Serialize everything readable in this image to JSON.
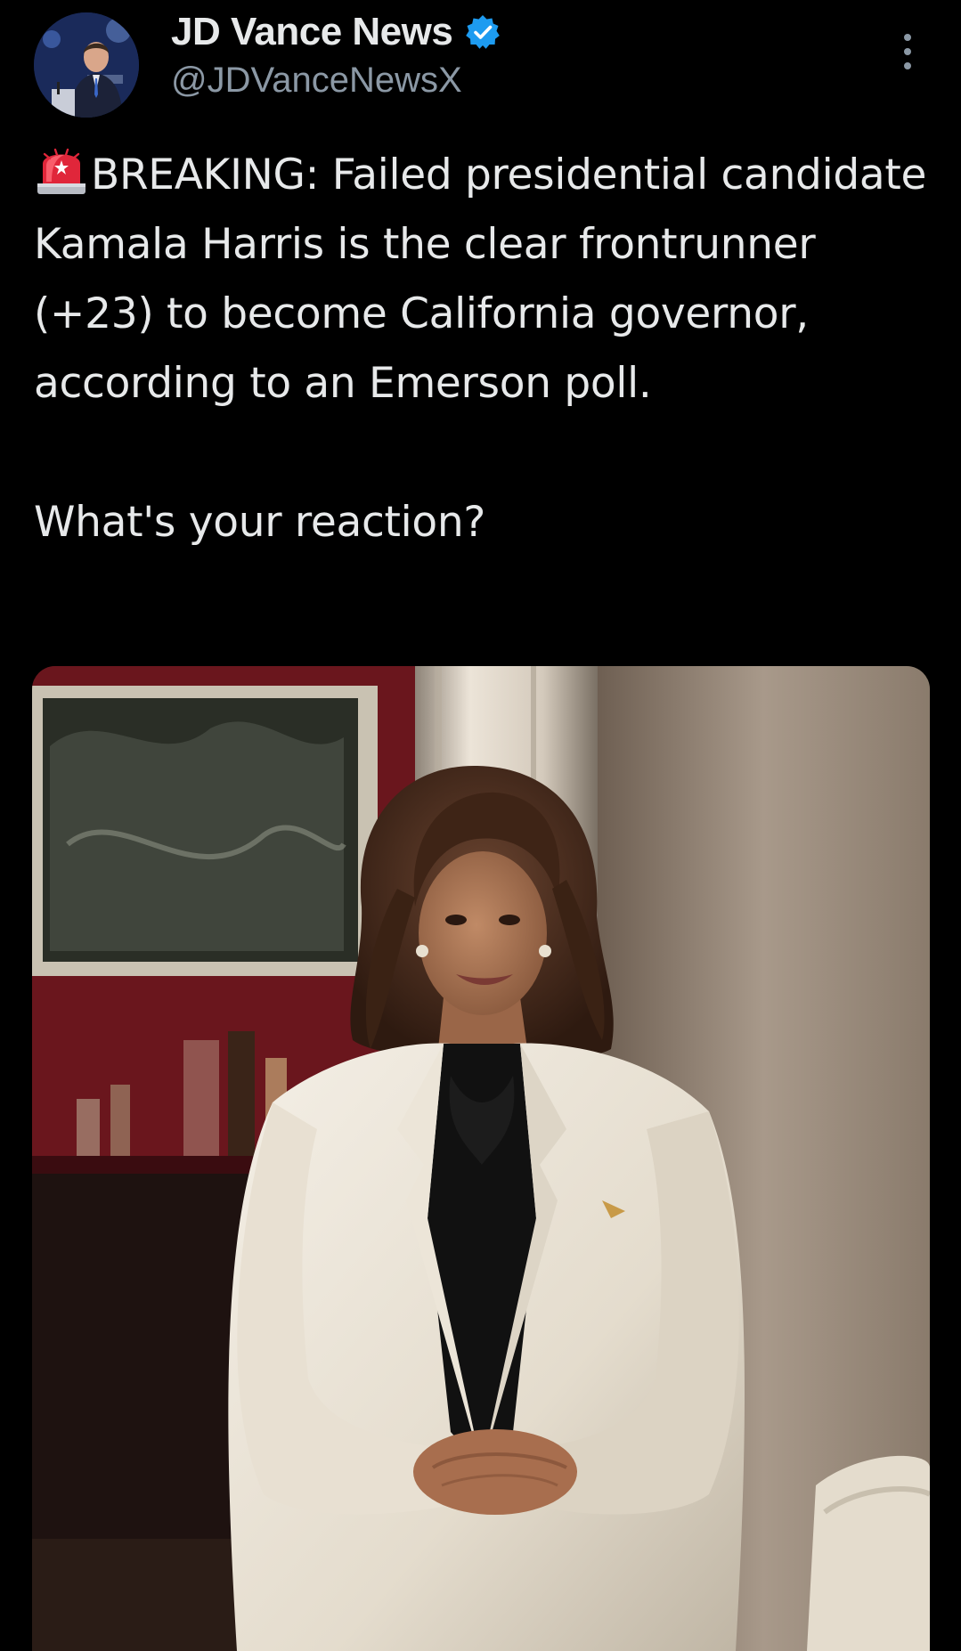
{
  "author": {
    "display_name": "JD Vance News",
    "handle": "@JDVanceNewsX",
    "verified": true,
    "avatar_icon": "avatar-image",
    "verified_icon": "verified-badge-icon"
  },
  "menu": {
    "icon": "more-options-icon"
  },
  "tweet": {
    "emoji_icon": "police-siren-emoji",
    "text_line1": "BREAKING: Failed presidential candidate Kamala Harris is the clear frontrunner (+23) to become California governor, according to an Emerson poll.",
    "text_line2": "What's your reaction?"
  },
  "media": {
    "type": "photo",
    "icon": "portrait-photo"
  },
  "colors": {
    "background": "#000000",
    "text_primary": "#e7e9ea",
    "text_secondary": "#8b98a5",
    "verified_blue": "#1d9bf0"
  }
}
